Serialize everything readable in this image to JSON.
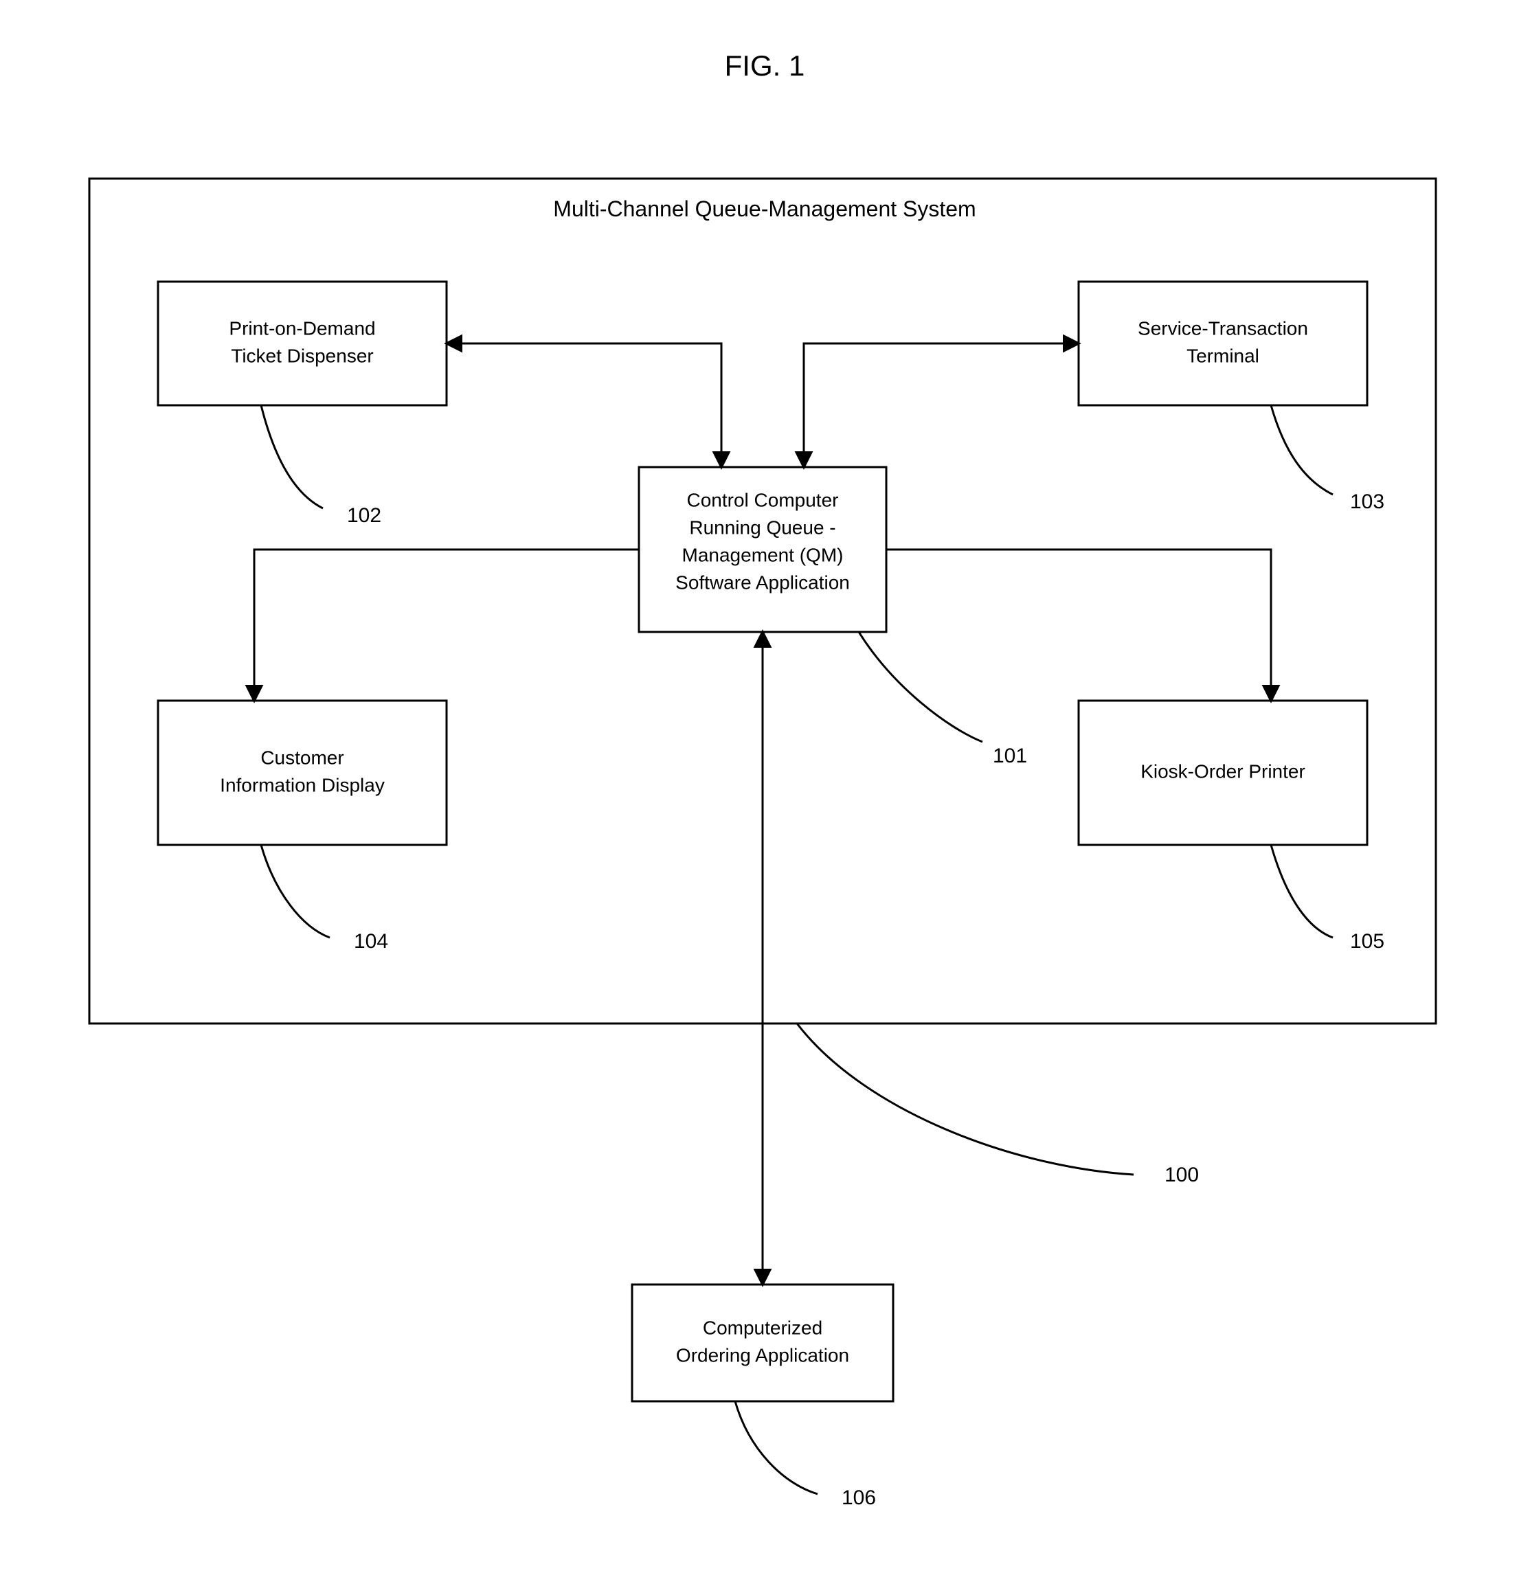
{
  "figure_label": "FIG. 1",
  "system_title": "Multi-Channel Queue-Management System",
  "boxes": {
    "dispenser": {
      "lines": [
        "Print-on-Demand",
        "Ticket Dispenser"
      ]
    },
    "terminal": {
      "lines": [
        "Service-Transaction",
        "Terminal"
      ]
    },
    "control": {
      "lines": [
        "Control Computer",
        "Running Queue -",
        "Management (QM)",
        "Software Application"
      ]
    },
    "display": {
      "lines": [
        "Customer",
        "Information Display"
      ]
    },
    "printer": {
      "lines": [
        "Kiosk-Order Printer"
      ]
    },
    "ordering": {
      "lines": [
        "Computerized",
        "Ordering Application"
      ]
    }
  },
  "refs": {
    "system": "100",
    "control": "101",
    "dispenser": "102",
    "terminal": "103",
    "display": "104",
    "printer": "105",
    "ordering": "106"
  }
}
